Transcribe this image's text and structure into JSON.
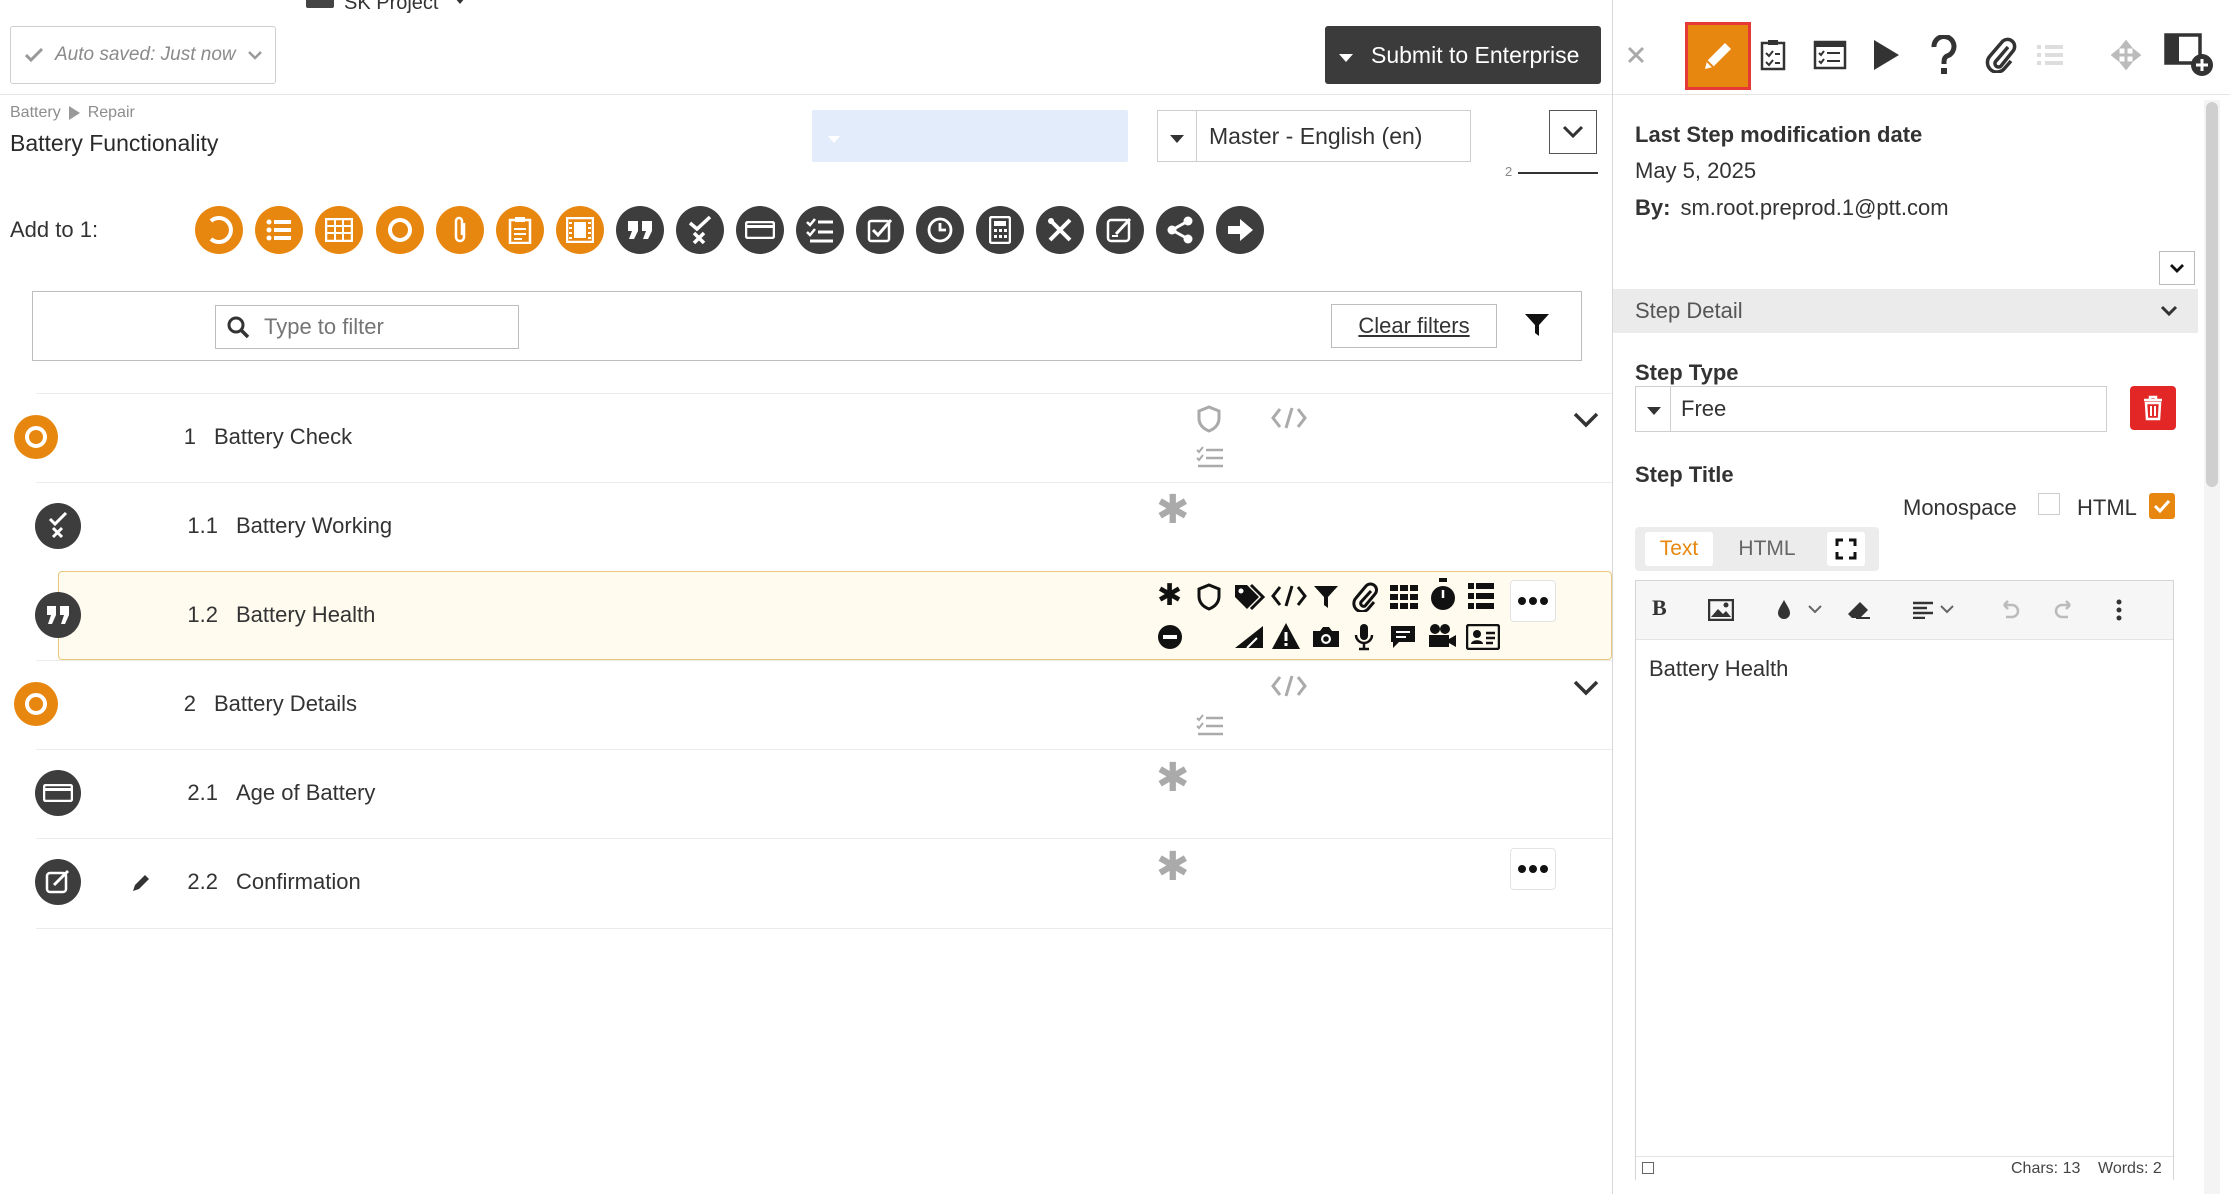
{
  "header": {
    "project_name": "SK Project",
    "autosave_label": "Auto saved: Just now",
    "submit_label": "Submit to Enterprise"
  },
  "breadcrumb": {
    "items": [
      "Battery",
      "Repair"
    ]
  },
  "page": {
    "title": "Battery Functionality",
    "language_value": "Master - English (en)",
    "step_counter": "2"
  },
  "toolbox": {
    "add_to_label": "Add to 1:",
    "tools": [
      {
        "icon": "partial-circle-icon",
        "color": "orange"
      },
      {
        "icon": "list-icon",
        "color": "orange"
      },
      {
        "icon": "table-icon",
        "color": "orange"
      },
      {
        "icon": "circle-icon",
        "color": "orange"
      },
      {
        "icon": "attachment-icon",
        "color": "orange"
      },
      {
        "icon": "clipboard-icon",
        "color": "orange"
      },
      {
        "icon": "film-icon",
        "color": "orange"
      },
      {
        "icon": "quote-icon",
        "color": "dark"
      },
      {
        "icon": "check-x-icon",
        "color": "dark"
      },
      {
        "icon": "input-box-icon",
        "color": "dark"
      },
      {
        "icon": "checklist-icon",
        "color": "dark"
      },
      {
        "icon": "checkbox-icon",
        "color": "dark"
      },
      {
        "icon": "clock-icon",
        "color": "dark"
      },
      {
        "icon": "calculator-icon",
        "color": "dark"
      },
      {
        "icon": "tools-icon",
        "color": "dark"
      },
      {
        "icon": "signature-icon",
        "color": "dark"
      },
      {
        "icon": "share-icon",
        "color": "dark"
      },
      {
        "icon": "arrow-right-icon",
        "color": "dark"
      }
    ]
  },
  "filter": {
    "placeholder": "Type to filter",
    "clear_label": "Clear filters"
  },
  "steps": [
    {
      "num": "1",
      "label": "Battery Check",
      "icon": "circle-icon"
    },
    {
      "num": "1.1",
      "label": "Battery Working",
      "icon": "check-x-icon"
    },
    {
      "num": "1.2",
      "label": "Battery Health",
      "icon": "quote-icon"
    },
    {
      "num": "2",
      "label": "Battery Details",
      "icon": "circle-icon"
    },
    {
      "num": "2.1",
      "label": "Age of Battery",
      "icon": "input-box-icon"
    },
    {
      "num": "2.2",
      "label": "Confirmation",
      "icon": "signature-icon"
    }
  ],
  "right_panel": {
    "mod_label": "Last Step modification date",
    "mod_date": "May 5, 2025",
    "by_label": "By:",
    "by_value": "sm.root.preprod.1@ptt.com",
    "step_detail_label": "Step Detail",
    "step_type_label": "Step Type",
    "step_type_value": "Free",
    "step_title_label": "Step Title",
    "monospace_label": "Monospace",
    "html_label": "HTML",
    "tab_text": "Text",
    "tab_html": "HTML",
    "editor_content": "Battery Health",
    "chars_label": "Chars: 13",
    "words_label": "Words: 2"
  },
  "colors": {
    "accent": "#e8870f",
    "dark": "#3d3d3d",
    "danger": "#e32626",
    "highlight_row": "#fffbef"
  }
}
